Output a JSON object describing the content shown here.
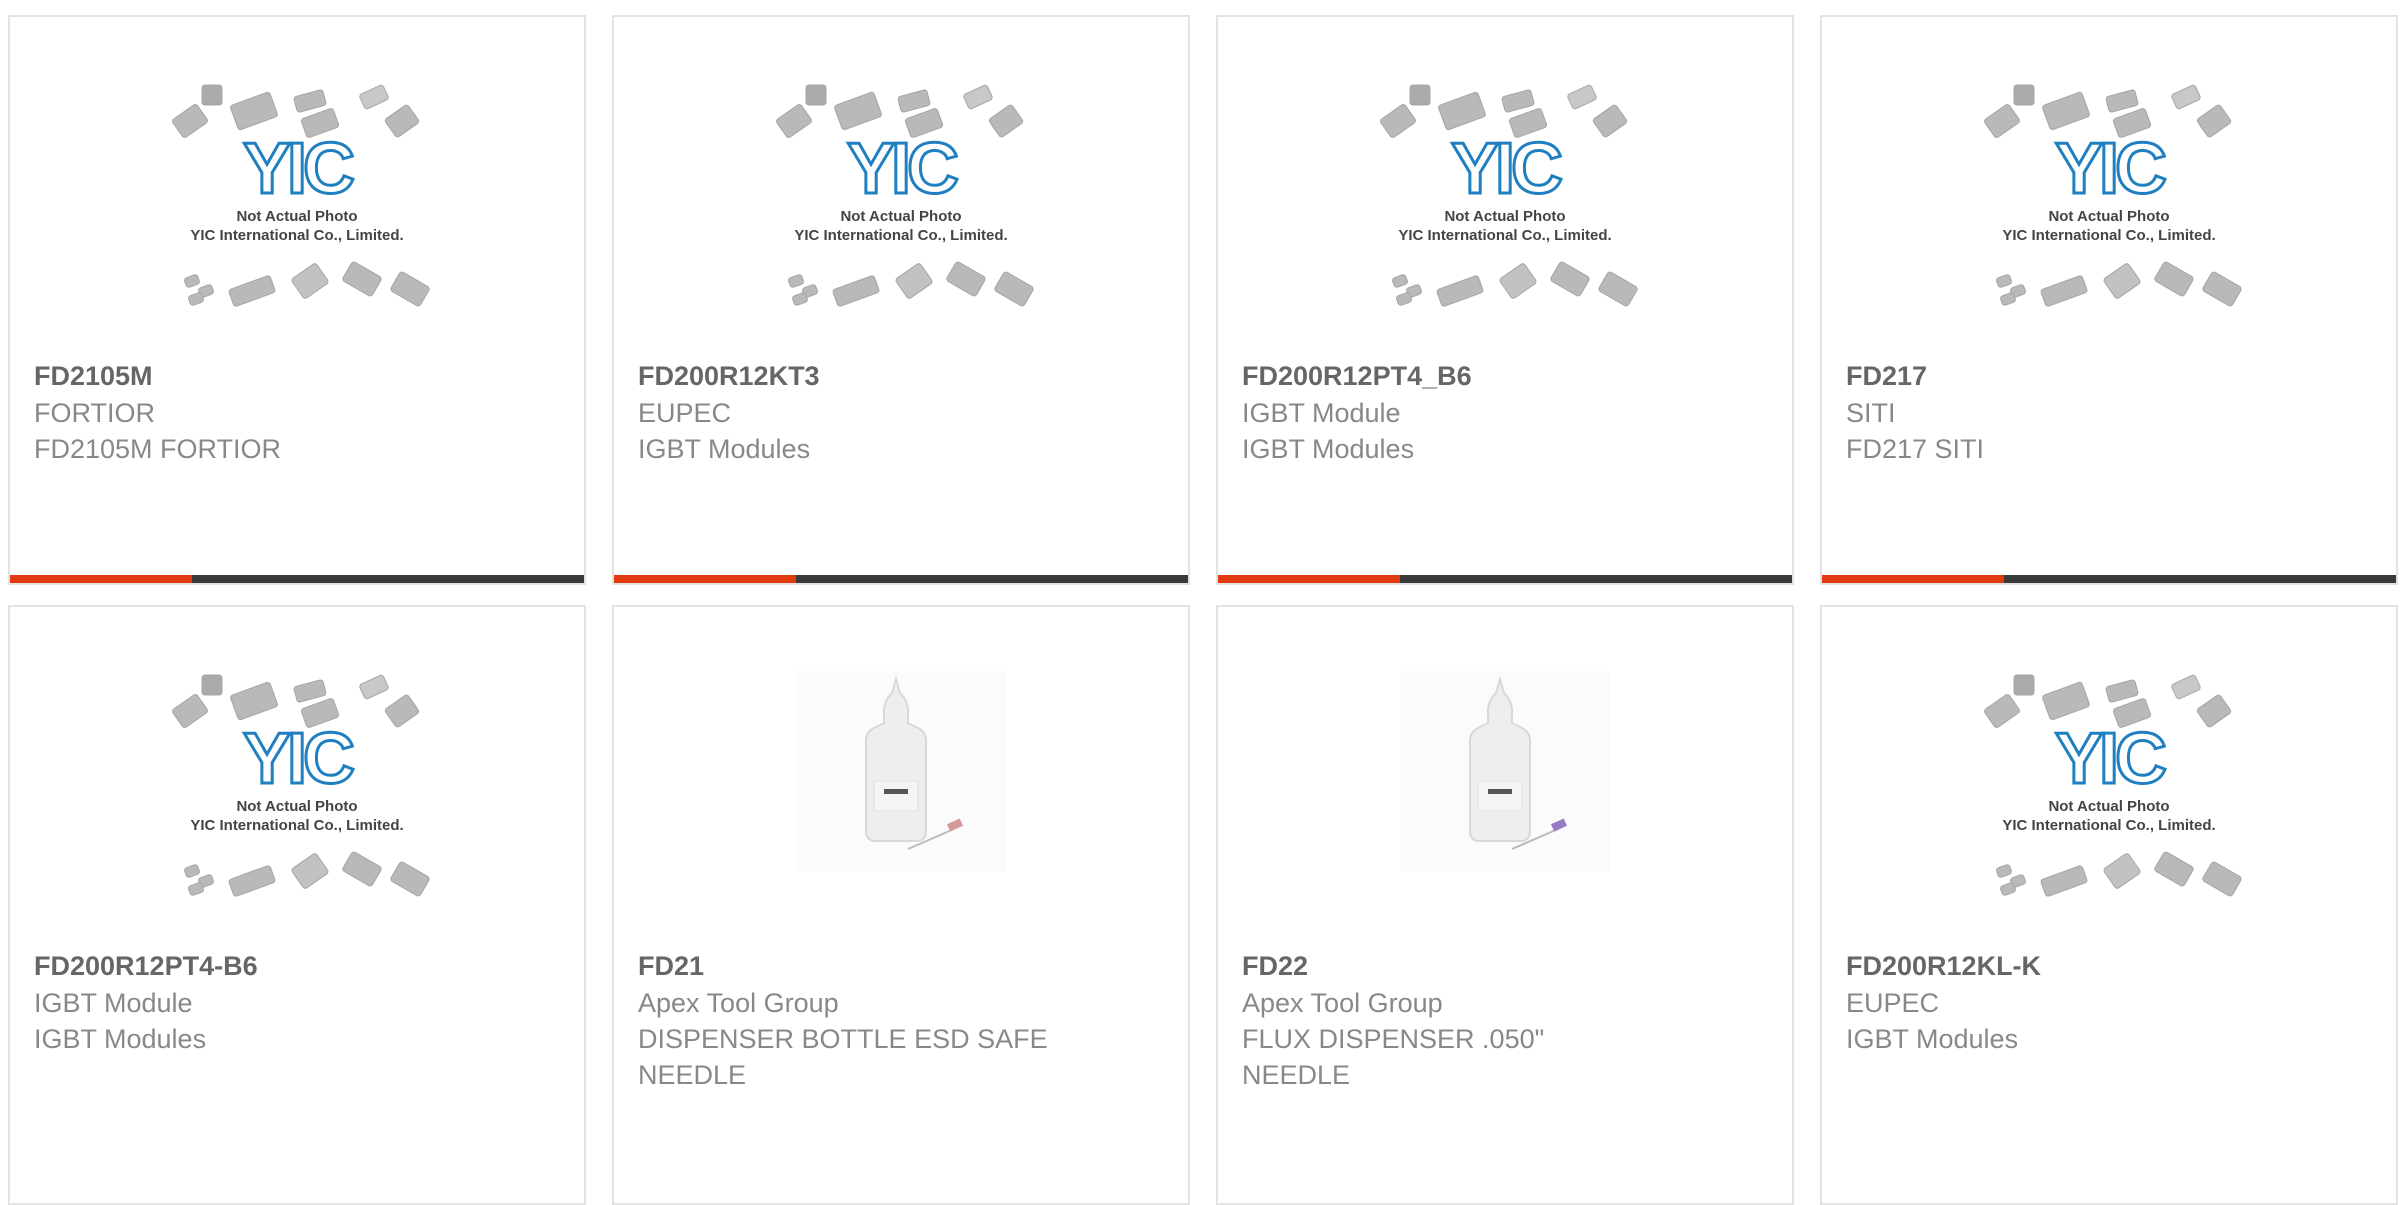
{
  "colors": {
    "accent": "#e03c0f",
    "bar": "#3a3a3a",
    "border": "#e3e3e3",
    "logo": "#1f7fc1"
  },
  "placeholder": {
    "logo_text": "YIC",
    "caption_line1": "Not Actual Photo",
    "caption_line2": "YIC International Co., Limited."
  },
  "products": [
    {
      "part": "FD2105M",
      "brand": "FORTIOR",
      "desc": "FD2105M FORTIOR",
      "desc2": "",
      "image": "placeholder-photo"
    },
    {
      "part": "FD200R12KT3",
      "brand": "EUPEC",
      "desc": "IGBT Modules",
      "desc2": "",
      "image": "placeholder-photo"
    },
    {
      "part": "FD200R12PT4_B6",
      "brand": "IGBT Module",
      "desc": "IGBT Modules",
      "desc2": "",
      "image": "placeholder-photo"
    },
    {
      "part": "FD217",
      "brand": "SITI",
      "desc": "FD217 SITI",
      "desc2": "",
      "image": "placeholder-photo"
    },
    {
      "part": "FD200R12PT4-B6",
      "brand": "IGBT Module",
      "desc": "IGBT Modules",
      "desc2": "",
      "image": "placeholder-photo"
    },
    {
      "part": "FD21",
      "brand": "Apex Tool Group",
      "desc": "DISPENSER BOTTLE ESD SAFE",
      "desc2": "NEEDLE",
      "image": "dispenser-bottle-photo"
    },
    {
      "part": "FD22",
      "brand": "Apex Tool Group",
      "desc": "FLUX DISPENSER .050\"",
      "desc2": "NEEDLE",
      "image": "dispenser-bottle-photo"
    },
    {
      "part": "FD200R12KL-K",
      "brand": "EUPEC",
      "desc": "IGBT Modules",
      "desc2": "",
      "image": "placeholder-photo"
    }
  ]
}
